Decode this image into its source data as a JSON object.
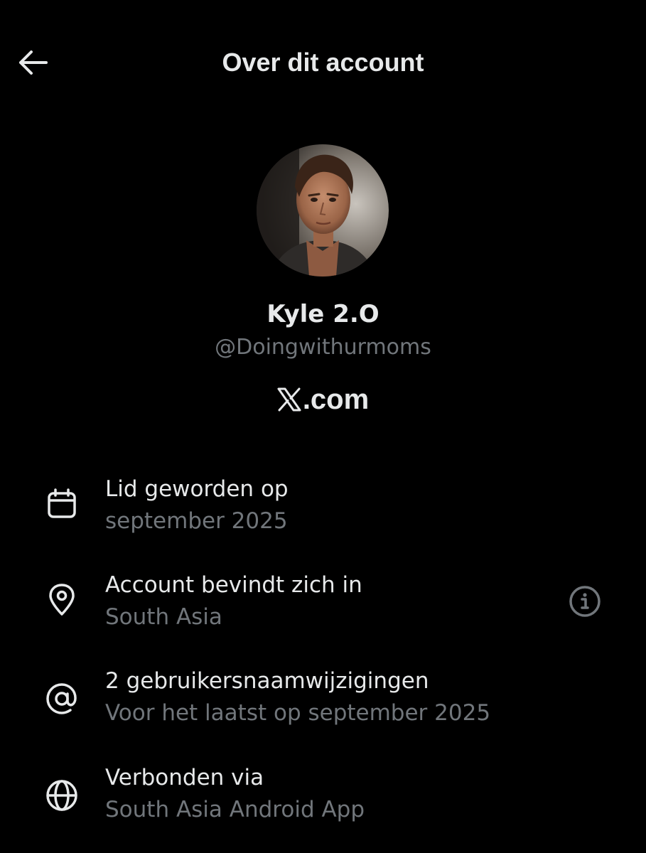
{
  "header": {
    "back_icon": "arrow-left-icon",
    "title": "Over dit account"
  },
  "profile": {
    "avatar_icon": "profile-photo",
    "name": "Kyle 2.O",
    "handle": "@Doingwithurmoms",
    "platform_logo": "x-logo-icon",
    "platform_text": ".com"
  },
  "details": [
    {
      "icon": "calendar-icon",
      "title": "Lid geworden op",
      "value": "september 2025"
    },
    {
      "icon": "location-pin-icon",
      "title": "Account bevindt zich in",
      "value": "South Asia",
      "action_icon": "info-icon"
    },
    {
      "icon": "at-sign-icon",
      "title": "2 gebruikersnaamwijzigingen",
      "value": "Voor het laatst op september 2025"
    },
    {
      "icon": "globe-icon",
      "title": "Verbonden via",
      "value": "South Asia Android App"
    }
  ],
  "colors": {
    "background": "#000000",
    "primary_text": "#e7e9ea",
    "secondary_text": "#71767b"
  }
}
